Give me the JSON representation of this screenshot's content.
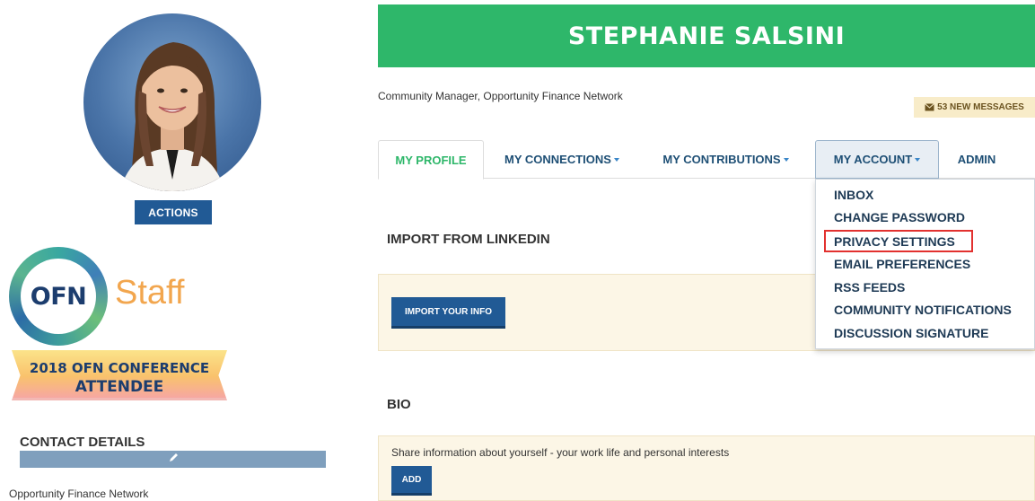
{
  "profile": {
    "name": "STEPHANIE SALSINI",
    "job_title": "Community Manager, Opportunity Finance Network",
    "actions_label": "ACTIONS"
  },
  "badges": {
    "ofn_logo_text": "OFN",
    "staff_label": "Staff",
    "conference_line1": "2018 OFN CONFERENCE",
    "conference_line2": "ATTENDEE"
  },
  "contact": {
    "title": "CONTACT DETAILS",
    "organization": "Opportunity Finance Network"
  },
  "messages": {
    "label": "53 NEW MESSAGES"
  },
  "tabs": [
    {
      "label": "MY PROFILE"
    },
    {
      "label": "MY CONNECTIONS"
    },
    {
      "label": "MY CONTRIBUTIONS"
    },
    {
      "label": "MY ACCOUNT"
    },
    {
      "label": "ADMIN"
    }
  ],
  "account_menu": [
    {
      "label": "INBOX"
    },
    {
      "label": "CHANGE PASSWORD"
    },
    {
      "label": "PRIVACY SETTINGS"
    },
    {
      "label": "EMAIL PREFERENCES"
    },
    {
      "label": "RSS FEEDS"
    },
    {
      "label": "COMMUNITY NOTIFICATIONS"
    },
    {
      "label": "DISCUSSION SIGNATURE"
    }
  ],
  "import": {
    "heading": "IMPORT FROM LINKEDIN",
    "button_label": "IMPORT YOUR INFO"
  },
  "bio": {
    "heading": "BIO",
    "description": "Share information about yourself - your work life and personal interests",
    "add_label": "ADD"
  },
  "colors": {
    "banner_green": "#2eb76a",
    "button_blue": "#215a95",
    "highlight_red": "#e2312f",
    "panel_cream": "#fcf6e6"
  },
  "icons": {
    "messages": "envelope-icon",
    "edit": "pencil-icon"
  }
}
